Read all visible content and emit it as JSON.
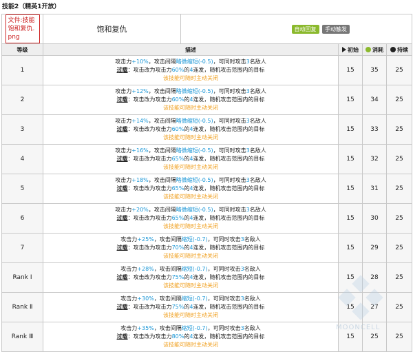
{
  "heading": "技能2（精英1开放）",
  "skill": {
    "file_link": "文件:技能 饱和复仇.png",
    "name": "饱和复仇",
    "recovery_badge": "自动回复",
    "trigger_badge": "手动触发"
  },
  "headers": {
    "level": "等级",
    "desc": "描述",
    "initial": "初始",
    "cost": "消耗",
    "duration": "持续"
  },
  "rows": [
    {
      "level": "1",
      "atk": "+10%",
      "interval": "略微缩短(-0.5)",
      "targets": "3",
      "atk_ratio": "60%",
      "shots": "4",
      "initial": "15",
      "cost": "35",
      "duration": "25"
    },
    {
      "level": "2",
      "atk": "+12%",
      "interval": "略微缩短(-0.5)",
      "targets": "3",
      "atk_ratio": "60%",
      "shots": "4",
      "initial": "15",
      "cost": "34",
      "duration": "25"
    },
    {
      "level": "3",
      "atk": "+14%",
      "interval": "略微缩短(-0.5)",
      "targets": "3",
      "atk_ratio": "60%",
      "shots": "4",
      "initial": "15",
      "cost": "33",
      "duration": "25"
    },
    {
      "level": "4",
      "atk": "+16%",
      "interval": "略微缩短(-0.5)",
      "targets": "3",
      "atk_ratio": "65%",
      "shots": "4",
      "initial": "15",
      "cost": "32",
      "duration": "25"
    },
    {
      "level": "5",
      "atk": "+18%",
      "interval": "略微缩短(-0.5)",
      "targets": "3",
      "atk_ratio": "65%",
      "shots": "4",
      "initial": "15",
      "cost": "31",
      "duration": "25"
    },
    {
      "level": "6",
      "atk": "+20%",
      "interval": "略微缩短(-0.5)",
      "targets": "3",
      "atk_ratio": "65%",
      "shots": "4",
      "initial": "15",
      "cost": "30",
      "duration": "25"
    },
    {
      "level": "7",
      "atk": "+25%",
      "interval": "缩短(-0.7)",
      "targets": "3",
      "atk_ratio": "70%",
      "shots": "4",
      "initial": "15",
      "cost": "29",
      "duration": "25"
    },
    {
      "level": "Rank Ⅰ",
      "atk": "+28%",
      "interval": "缩短(-0.7)",
      "targets": "3",
      "atk_ratio": "75%",
      "shots": "4",
      "initial": "15",
      "cost": "28",
      "duration": "25"
    },
    {
      "level": "Rank Ⅱ",
      "atk": "+30%",
      "interval": "缩短(-0.7)",
      "targets": "3",
      "atk_ratio": "75%",
      "shots": "4",
      "initial": "15",
      "cost": "27",
      "duration": "25"
    },
    {
      "level": "Rank Ⅲ",
      "atk": "+35%",
      "interval": "缩短(-0.7)",
      "targets": "3",
      "atk_ratio": "80%",
      "shots": "4",
      "initial": "15",
      "cost": "25",
      "duration": "25"
    }
  ],
  "desc_text": {
    "atk_prefix": "攻击力",
    "interval_prefix": "，攻击间隔",
    "targets_prefix": "，可同时攻击",
    "targets_suffix": "名敌人",
    "overload_label": "过载",
    "overload_prefix": "：攻击改为攻击力",
    "shots_prefix": "的",
    "shots_suffix": "连发，随机攻击范围内的目标",
    "note": "该技能可随时主动关闭"
  },
  "watermark": "MOONCELL",
  "colors": {
    "value_blue": "#1a96d6",
    "note_orange": "#f0a020",
    "auto_badge": "#8bb92d",
    "manual_badge": "#777777",
    "header_bg": "#eeeeee",
    "border": "#c8c8c8"
  }
}
